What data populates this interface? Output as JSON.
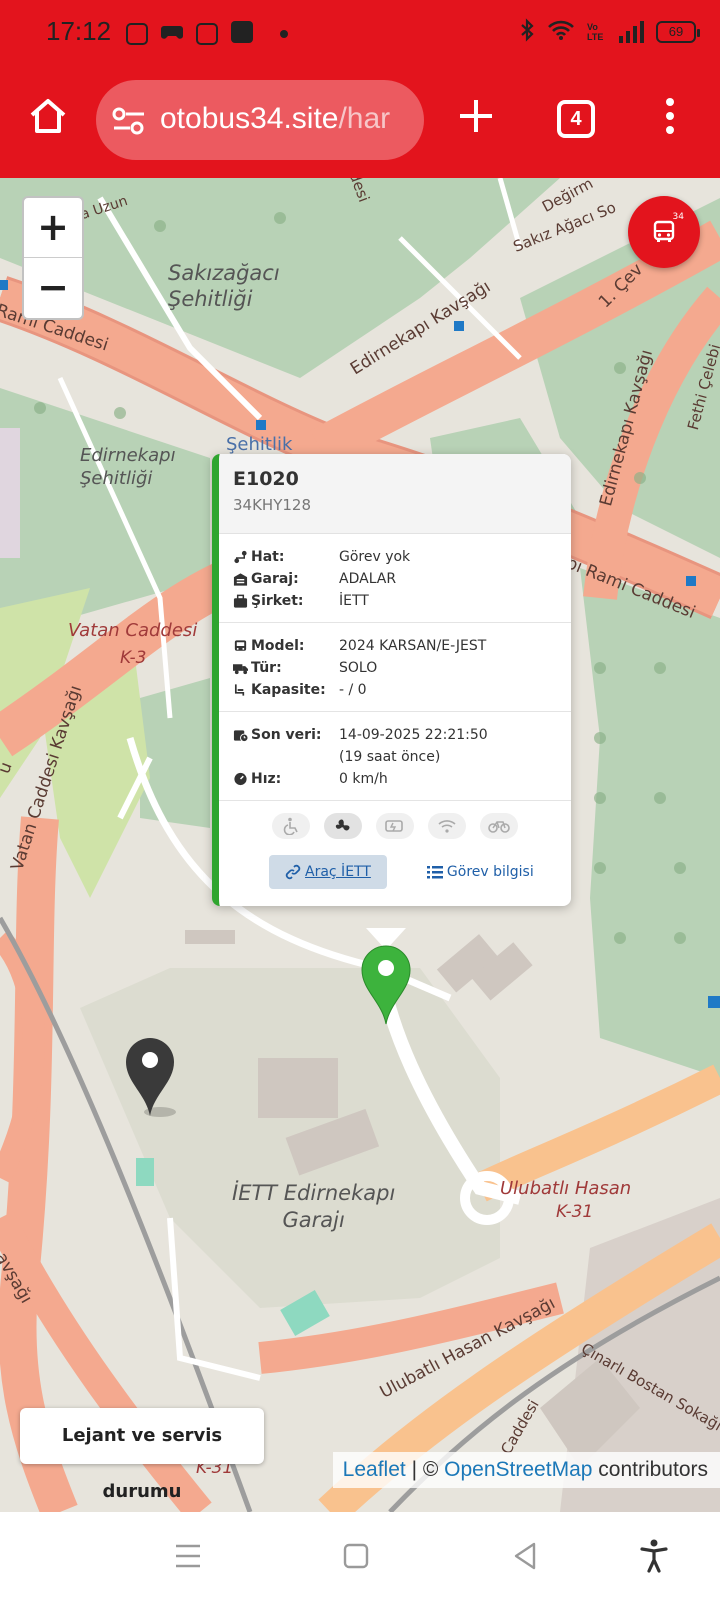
{
  "status": {
    "time": "17:12",
    "battery": "69",
    "net_label": "Vo LTE"
  },
  "browser": {
    "url_domain": "otobus34.site",
    "url_path": "/har",
    "tab_count": "4"
  },
  "map": {
    "labels": {
      "sakizagaci": "Sakızağacı\nŞehitliği",
      "edirnekapi_sehitligi": "Edirnekapı\nŞehitliği",
      "sehitlik": "Şehitlik",
      "iett_garaji": "İETT Edirnekapı\nGarajı",
      "vatan_caddesi": "Vatan Caddesi",
      "k3": "K-3",
      "vatan_kavsagi": "Vatan Caddesi Kavşağı",
      "edirnekapi_kavsagi": "Edirnekapı Kavşağı",
      "edirnekapi_kavsagi_2": "Edirnekapı Kavşağı",
      "rami_caddesi": "Rami Caddesi",
      "rami_caddesi_2": "pı Rami Caddesi",
      "ulubatli_hasan": "Ulubatlı Hasan",
      "k31": "K-31",
      "k31_bottom": "K-31",
      "ulubatli_kavsagi": "Ulubatlı Hasan Kavşağı",
      "cinarli_bostan": "Çınarlı Bostan Sokağı",
      "sakiz_agaci_so": "Sakız Ağacı So",
      "degirmen": "Değirm",
      "cevre": "1. Çev",
      "fethi": "Fethi Çelebi",
      "uzun": "a Uzun",
      "kavsagi_left": "avşağı",
      "u_left": "u",
      "caddesi_bottom": "Caddesi",
      "desi_top": "desi"
    },
    "zoom_in": "+",
    "zoom_out": "−",
    "bus_fab_number": "34",
    "legend_button": "Lejant ve servis durumu",
    "attribution": {
      "leaflet": "Leaflet",
      "separator": " | © ",
      "osm": "OpenStreetMap",
      "suffix": " contributors"
    }
  },
  "popup": {
    "vehicle_id": "E1020",
    "plate": "34KHY128",
    "rows1": [
      {
        "label": "Hat:",
        "value": "Görev yok",
        "icon": "route-icon"
      },
      {
        "label": "Garaj:",
        "value": "ADALAR",
        "icon": "garage-icon"
      },
      {
        "label": "Şirket:",
        "value": "İETT",
        "icon": "briefcase-icon"
      }
    ],
    "rows2": [
      {
        "label": "Model:",
        "value": "2024 KARSAN/E-JEST",
        "icon": "bus-icon"
      },
      {
        "label": "Tür:",
        "value": "SOLO",
        "icon": "truck-icon"
      },
      {
        "label": "Kapasite:",
        "value": "- / 0",
        "icon": "seat-icon"
      }
    ],
    "rows3": [
      {
        "label": "Son veri:",
        "value": "14-09-2025 22:21:50",
        "icon": "calendar-clock-icon"
      },
      {
        "label": "",
        "value": "(19 saat önce)",
        "icon": ""
      },
      {
        "label": "Hız:",
        "value": "0 km/h",
        "icon": "speedometer-icon"
      }
    ],
    "features": [
      {
        "name": "wheelchair-icon",
        "active": false
      },
      {
        "name": "fan-icon",
        "active": true
      },
      {
        "name": "usb-charger-icon",
        "active": false
      },
      {
        "name": "wifi-icon",
        "active": false
      },
      {
        "name": "bicycle-icon",
        "active": false
      }
    ],
    "btn_vehicle": "Araç İETT",
    "btn_task": "Görev bilgisi"
  },
  "colors": {
    "brand_red": "#e3141d",
    "popup_accent": "#2fa52f",
    "link_blue": "#1f5fa8"
  }
}
